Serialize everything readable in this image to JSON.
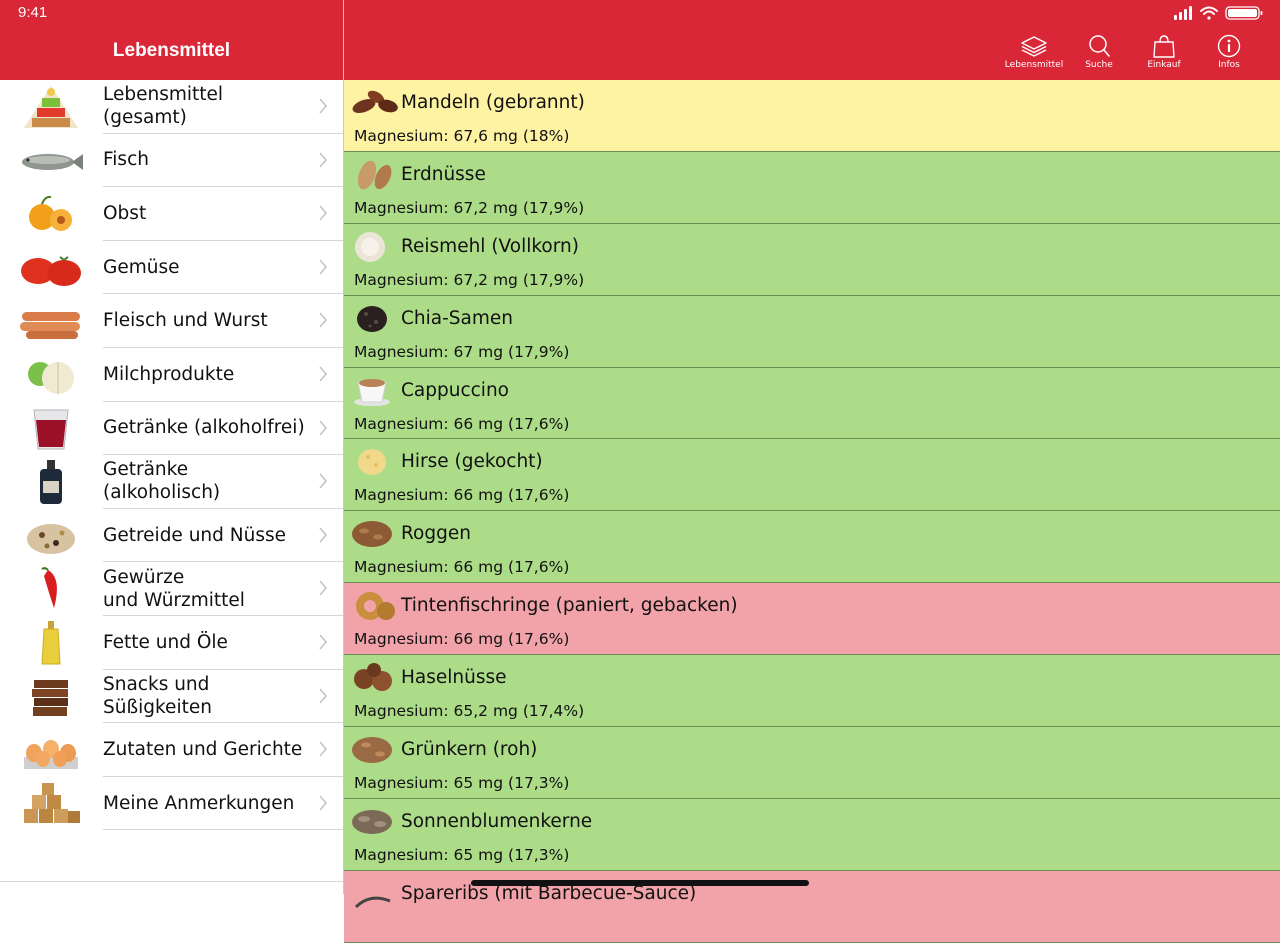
{
  "status": {
    "time": "9:41"
  },
  "sidebar": {
    "title": "Lebensmittel",
    "items": [
      {
        "label": "Lebensmittel (gesamt)",
        "icon": "food-pyramid-icon"
      },
      {
        "label": "Fisch",
        "icon": "fish-icon"
      },
      {
        "label": "Obst",
        "icon": "fruit-icon"
      },
      {
        "label": "Gemüse",
        "icon": "tomato-icon"
      },
      {
        "label": "Fleisch und Wurst",
        "icon": "sausage-icon"
      },
      {
        "label": "Milchprodukte",
        "icon": "cheese-icon"
      },
      {
        "label": "Getränke (alkoholfrei)",
        "icon": "juice-glass-icon"
      },
      {
        "label": "Getränke (alkoholisch)",
        "icon": "bottle-icon"
      },
      {
        "label": "Getreide und Nüsse",
        "icon": "grains-icon"
      },
      {
        "label": "Gewürze\nund Würzmittel",
        "icon": "chili-icon"
      },
      {
        "label": "Fette und Öle",
        "icon": "oil-bottle-icon"
      },
      {
        "label": "Snacks und\nSüßigkeiten",
        "icon": "chocolate-icon"
      },
      {
        "label": "Zutaten und Gerichte",
        "icon": "eggs-icon"
      },
      {
        "label": "Meine Anmerkungen",
        "icon": "sugar-cubes-icon"
      }
    ]
  },
  "toolbar": {
    "lebensmittel": "Lebensmittel",
    "suche": "Suche",
    "einkauf": "Einkauf",
    "infos": "Infos"
  },
  "colors": {
    "header": "#d92738",
    "yellow": "#fef3a2",
    "green": "#addc88",
    "red": "#f2a3a9"
  },
  "foods": [
    {
      "name": "Mandeln (gebrannt)",
      "value": "Magnesium: 67,6 mg (18%)",
      "color": "yellow",
      "icon": "almond-icon"
    },
    {
      "name": "Erdnüsse",
      "value": "Magnesium: 67,2 mg (17,9%)",
      "color": "green",
      "icon": "peanut-icon"
    },
    {
      "name": "Reismehl (Vollkorn)",
      "value": "Magnesium: 67,2 mg (17,9%)",
      "color": "green",
      "icon": "flour-icon"
    },
    {
      "name": "Chia-Samen",
      "value": "Magnesium: 67 mg (17,9%)",
      "color": "green",
      "icon": "seeds-icon"
    },
    {
      "name": "Cappuccino",
      "value": "Magnesium: 66 mg (17,6%)",
      "color": "green",
      "icon": "coffee-cup-icon"
    },
    {
      "name": "Hirse (gekocht)",
      "value": "Magnesium: 66 mg (17,6%)",
      "color": "green",
      "icon": "millet-icon"
    },
    {
      "name": "Roggen",
      "value": "Magnesium: 66 mg (17,6%)",
      "color": "green",
      "icon": "rye-icon"
    },
    {
      "name": "Tintenfischringe (paniert, gebacken)",
      "value": "Magnesium: 66 mg (17,6%)",
      "color": "red",
      "icon": "calamari-icon"
    },
    {
      "name": "Haselnüsse",
      "value": "Magnesium: 65,2 mg (17,4%)",
      "color": "green",
      "icon": "hazelnut-icon"
    },
    {
      "name": "Grünkern (roh)",
      "value": "Magnesium: 65 mg (17,3%)",
      "color": "green",
      "icon": "spelt-icon"
    },
    {
      "name": "Sonnenblumenkerne",
      "value": "Magnesium: 65 mg (17,3%)",
      "color": "green",
      "icon": "sunflower-seeds-icon"
    },
    {
      "name": "Spareribs (mit Barbecue-Sauce)",
      "value": "",
      "color": "red",
      "icon": "spareribs-icon"
    }
  ]
}
